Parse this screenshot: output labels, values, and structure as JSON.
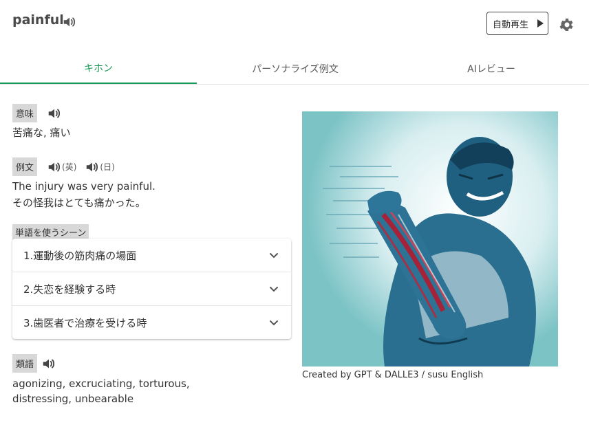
{
  "header": {
    "word": "painful",
    "autoplay_label": "自動再生",
    "icons": {
      "speaker": "speaker-icon",
      "play": "play-icon",
      "settings": "gear-icon"
    }
  },
  "tabs": [
    {
      "label": "キホン",
      "active": true
    },
    {
      "label": "パーソナライズ例文",
      "active": false
    },
    {
      "label": "AIレビュー",
      "active": false
    }
  ],
  "meaning": {
    "label": "意味",
    "text": "苦痛な,  痛い"
  },
  "example": {
    "label": "例文",
    "audio_en": "(英)",
    "audio_ja": "(日)",
    "sentence_en": "The injury was very painful.",
    "sentence_ja": "その怪我はとても痛かった。"
  },
  "scenes": {
    "label": "単語を使うシーン",
    "items": [
      "1.運動後の筋肉痛の場面",
      "2.失恋を経験する時",
      "3.歯医者で治療を受ける時"
    ]
  },
  "synonyms": {
    "label": "類語",
    "text": "agonizing, excruciating, torturous, distressing, unbearable"
  },
  "image": {
    "credit": "Created by GPT & DALLE3 / susu English"
  },
  "colors": {
    "accent": "#1a9a57",
    "chip": "#d8d8d8",
    "illustration_bg": "#7cc3c6",
    "pain": "#b3192f"
  }
}
